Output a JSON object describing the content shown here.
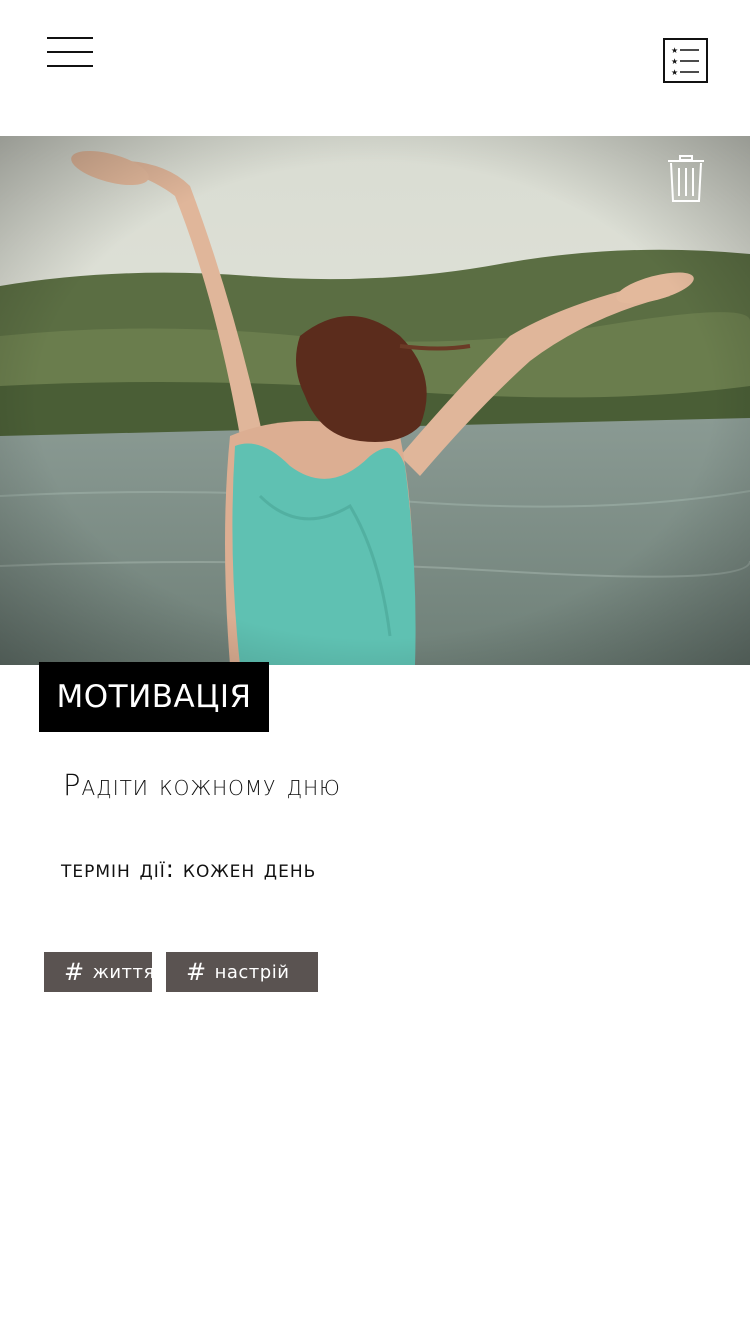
{
  "header": {
    "menu_icon": "hamburger-menu-icon",
    "list_icon": "starred-list-icon"
  },
  "hero": {
    "image": "woman-with-raised-arms-by-lake-photo",
    "delete_icon": "trash-icon",
    "colors": {
      "sky": "#dfe2d9",
      "hills": "#56693f",
      "water": "#7d8f87",
      "top": "#5fc1b2"
    }
  },
  "goal": {
    "category": "МОТИВАЦІЯ",
    "title": "Радіти кожному дню",
    "deadline_label": "термін дії:",
    "deadline_value": "кожен день"
  },
  "tags": [
    {
      "hash": "#",
      "label": "життя"
    },
    {
      "hash": "#",
      "label": "настрій"
    }
  ],
  "colors": {
    "tag_bg": "#5a5351",
    "category_bg": "#000000"
  }
}
